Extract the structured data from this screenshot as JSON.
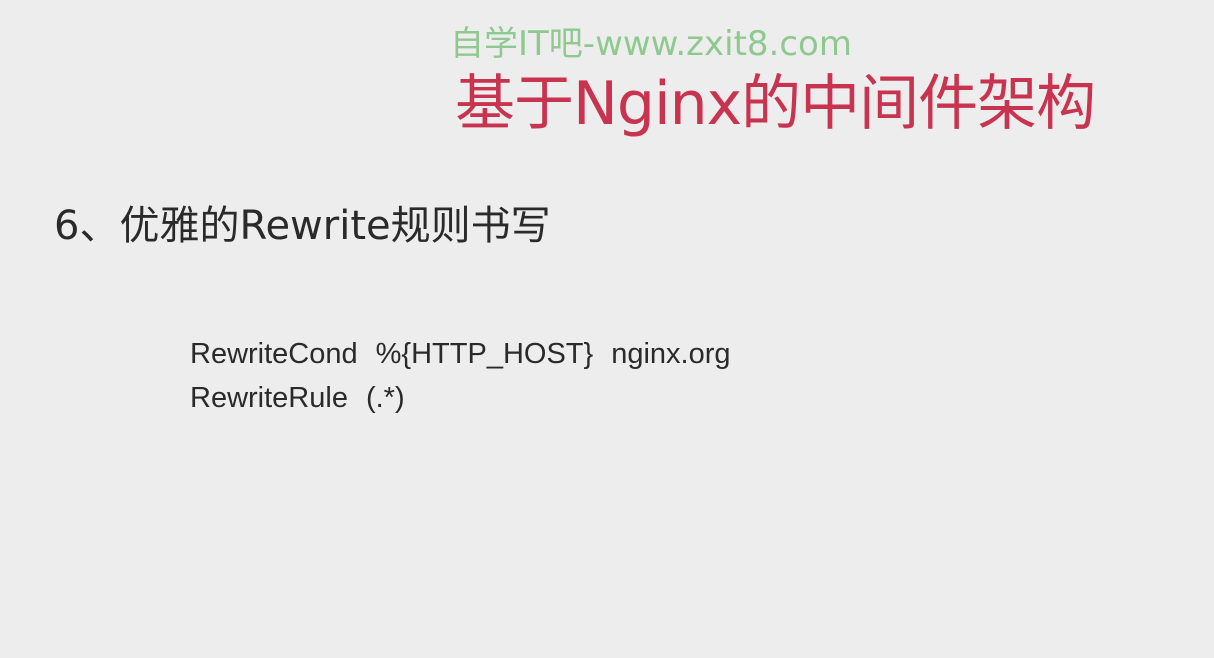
{
  "slide": {
    "watermark": "自学IT吧-www.zxit8.com",
    "title": "基于Nginx的中间件架构",
    "section_heading": "6、优雅的Rewrite规则书写",
    "code": [
      {
        "directive": "RewriteCond",
        "arg1": "%{HTTP_HOST}",
        "arg2": "nginx.org"
      },
      {
        "directive": "RewriteRule",
        "arg1": "(.*)",
        "arg2": ""
      }
    ]
  },
  "colors": {
    "background": "#ededed",
    "title": "#c8344f",
    "watermark": "#8fc98f",
    "text": "#2a2a2a"
  }
}
